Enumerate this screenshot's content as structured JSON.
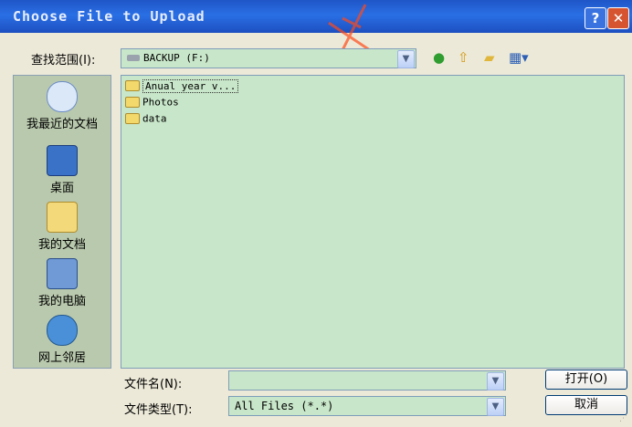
{
  "window": {
    "title": "Choose File to Upload",
    "help_label": "?",
    "close_label": "✕"
  },
  "look_in": {
    "label": "查找范围(I):",
    "value": "BACKUP (F:)"
  },
  "toolbar": {
    "back_icon": "back-icon",
    "up_icon": "up-folder-icon",
    "new_folder_icon": "new-folder-icon",
    "view_menu_icon": "view-menu-icon"
  },
  "places": [
    {
      "label": "我最近的文档",
      "icon": "recent-documents-icon"
    },
    {
      "label": "桌面",
      "icon": "desktop-icon"
    },
    {
      "label": "我的文档",
      "icon": "my-documents-icon"
    },
    {
      "label": "我的电脑",
      "icon": "my-computer-icon"
    },
    {
      "label": "网上邻居",
      "icon": "network-places-icon"
    }
  ],
  "files": [
    {
      "name": "Anual year v..."
    },
    {
      "name": "Photos"
    },
    {
      "name": "data"
    }
  ],
  "filename": {
    "label": "文件名(N):",
    "value": ""
  },
  "filetype": {
    "label": "文件类型(T):",
    "value": "All Files (*.*)"
  },
  "buttons": {
    "open": "打开(O)",
    "cancel": "取消"
  },
  "colors": {
    "title_bar": "#2a6fe5",
    "field_background": "#c8e6c9",
    "dialog_background": "#ece9d8"
  }
}
